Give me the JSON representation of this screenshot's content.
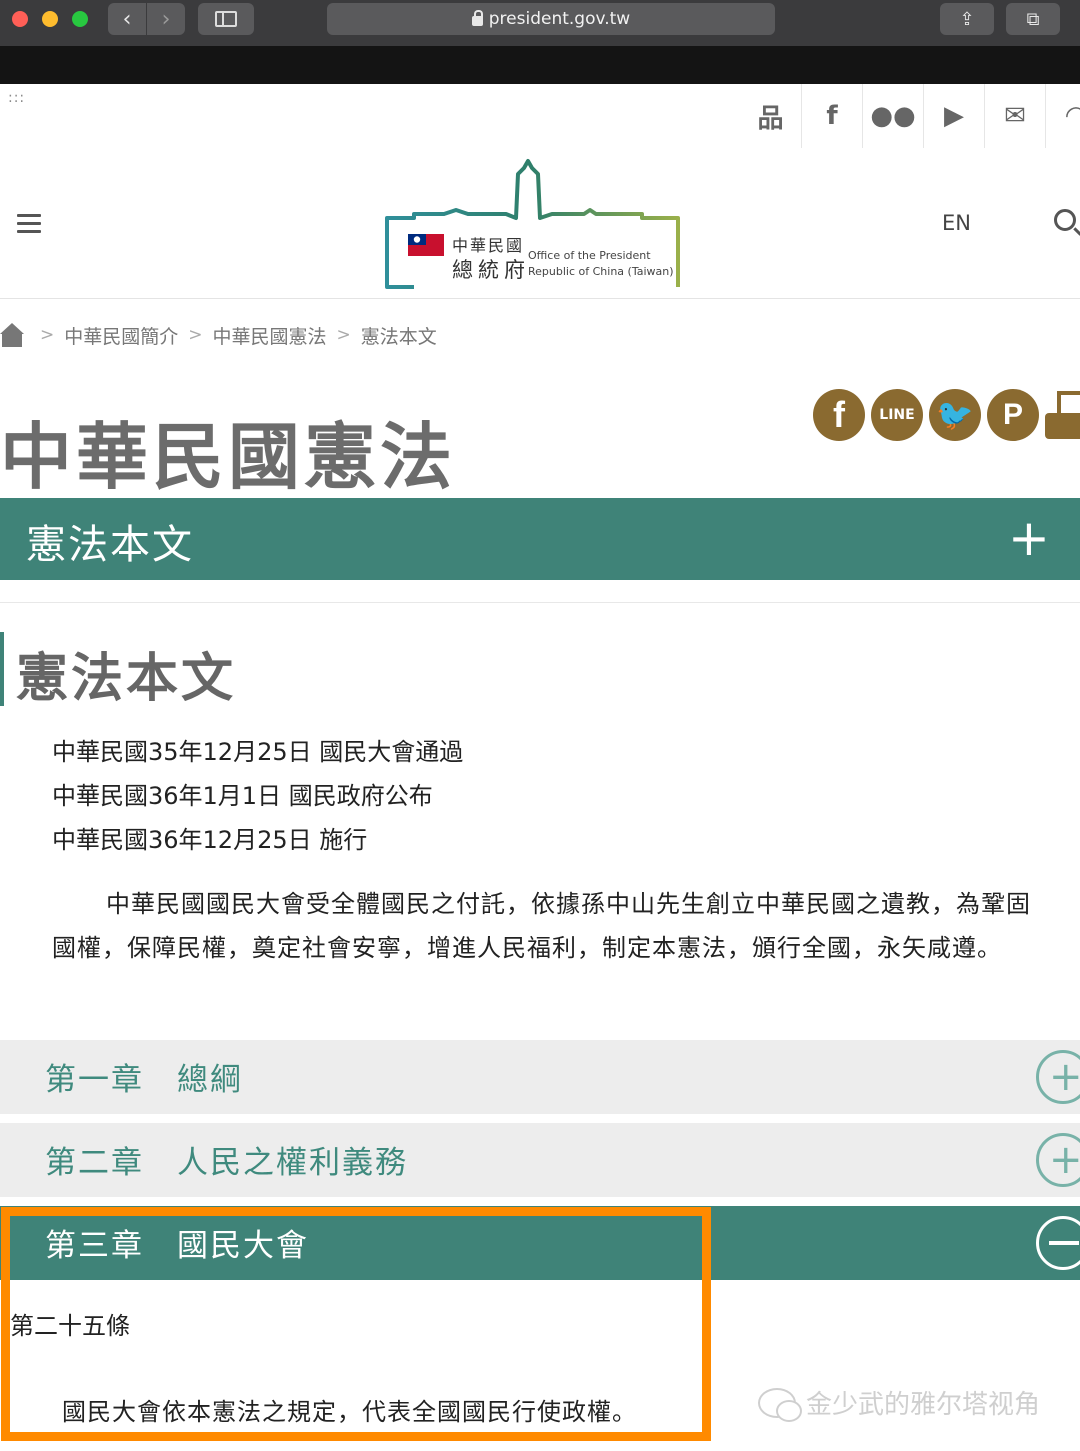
{
  "browser": {
    "url": "president.gov.tw",
    "back_glyph": "‹",
    "forward_glyph": "›",
    "share_glyph": "⇪",
    "tabs_glyph": "⧉"
  },
  "top_bar": {
    "icons": [
      {
        "name": "sitemap-icon",
        "glyph": "品"
      },
      {
        "name": "facebook-icon",
        "glyph": "f"
      },
      {
        "name": "flickr-icon",
        "glyph": "●●"
      },
      {
        "name": "youtube-icon",
        "glyph": "▶"
      },
      {
        "name": "mail-icon",
        "glyph": "✉"
      },
      {
        "name": "rss-icon",
        "glyph": "◠"
      }
    ]
  },
  "header": {
    "logo_zh_line1": "中華民國",
    "logo_zh_line2": "總統府",
    "logo_en_line1": "Office of the President",
    "logo_en_line2": "Republic of China (Taiwan)",
    "lang_label": "EN"
  },
  "breadcrumb": {
    "separator": ">",
    "items": [
      "中華民國簡介",
      "中華民國憲法",
      "憲法本文"
    ]
  },
  "page": {
    "title": "中華民國憲法",
    "share": {
      "facebook": "f",
      "line": "LINE",
      "twitter": "🐦",
      "plurk": "P"
    }
  },
  "section": {
    "title": "憲法本文",
    "toggle": "+"
  },
  "article": {
    "title": "憲法本文",
    "dates": [
      "中華民國35年12月25日 國民大會通過",
      "中華民國36年1月1日 國民政府公布",
      "中華民國36年12月25日 施行"
    ],
    "preamble": "中華民國國民大會受全體國民之付託，依據孫中山先生創立中華民國之遺教，為鞏固國權，保障民權，奠定社會安寧，增進人民福利，制定本憲法，頒行全國，永矢咸遵。"
  },
  "chapters": [
    {
      "title": "第一章　總綱",
      "toggle": "+",
      "expanded": false
    },
    {
      "title": "第二章　人民之權利義務",
      "toggle": "+",
      "expanded": false
    },
    {
      "title": "第三章　國民大會",
      "toggle": "−",
      "expanded": true
    }
  ],
  "open_article": {
    "number": "第二十五條",
    "text": "國民大會依本憲法之規定，代表全國國民行使政權。"
  },
  "watermark": {
    "text": "金少武的雅尔塔视角"
  },
  "colors": {
    "accent_green": "#3f8378",
    "chapter_bg": "#ededed",
    "share_brown": "#8a6a30",
    "highlight_orange": "#ff8a00"
  }
}
